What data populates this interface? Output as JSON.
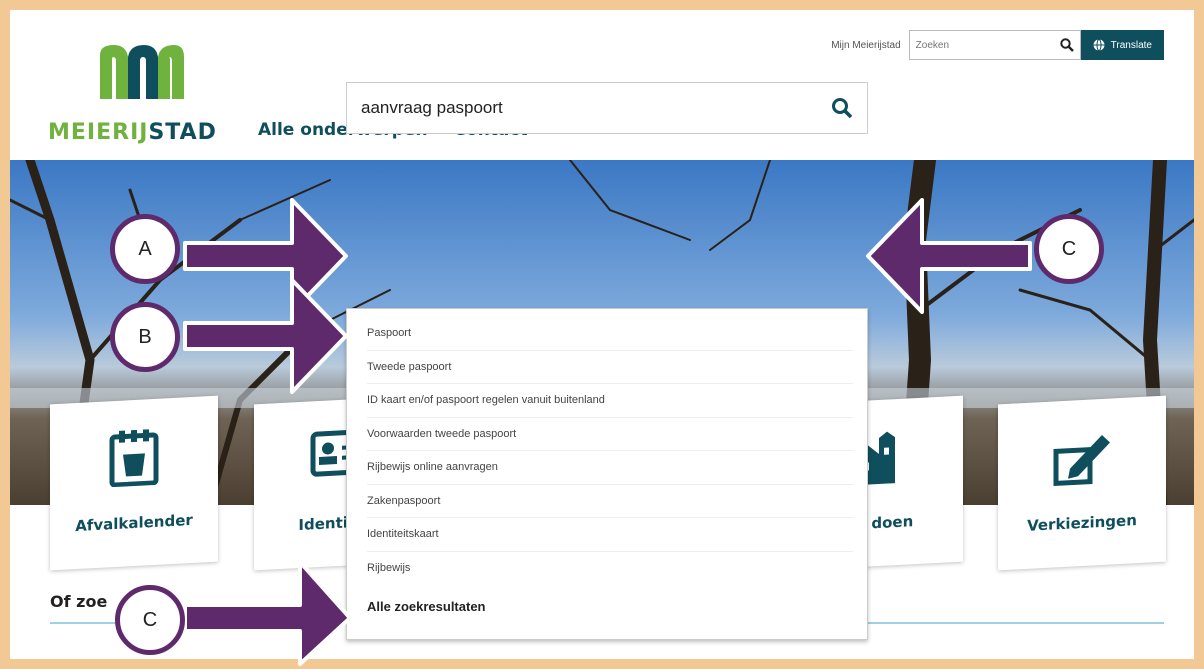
{
  "site": {
    "brand_part1": "MEIERIJ",
    "brand_part2": "STAD",
    "nav": [
      "Alle onderwerpen",
      "Contact"
    ],
    "top_link": "Mijn Meierijstad",
    "top_search_placeholder": "Zoeken",
    "translate_label": "Translate"
  },
  "hero_search": {
    "value": "aanvraag paspoort"
  },
  "suggestions": [
    "Paspoort",
    "Tweede paspoort",
    "ID kaart en/of paspoort regelen vanuit buitenland",
    "Voorwaarden tweede paspoort",
    "Rijbewijs online aanvragen",
    "Zakenpaspoort",
    "Identiteitskaart",
    "Rijbewijs"
  ],
  "suggestions_all": "Alle zoekresultaten",
  "tiles": [
    "Afvalkalender",
    "Identiteit",
    "ng doen",
    "Verkiezingen"
  ],
  "section_heading": "Of zoe",
  "callouts": [
    "A",
    "B",
    "C",
    "C"
  ],
  "colors": {
    "brand_dark": "#0f4e5c",
    "brand_green": "#6fb23e",
    "arrow_purple": "#5e2a6b",
    "frame": "#f2c894"
  }
}
